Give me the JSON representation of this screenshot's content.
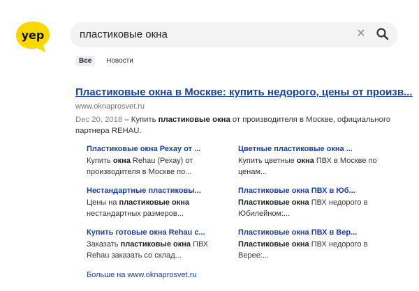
{
  "brand": {
    "logo_text": "yep",
    "color": "#f9d800"
  },
  "search": {
    "query": "пластиковые окна",
    "clear_icon": "close-icon",
    "search_icon": "search-icon"
  },
  "tabs": [
    {
      "label": "Все",
      "active": true
    },
    {
      "label": "Новости",
      "active": false
    }
  ],
  "result": {
    "title": "Пластиковые окна в Москве: купить недорого, цены от произв...",
    "url": "www.oknaprosvet.ru",
    "date": "Dec 20, 2018",
    "snippet_pre": " – Купить ",
    "snippet_bold": "пластиковые окна",
    "snippet_post": " от производителя в Москве, официального партнера REHAU."
  },
  "sitelinks": [
    {
      "title": "Пластиковые окна Рехау от ...",
      "desc": [
        [
          "Купить ",
          false
        ],
        [
          "окна",
          true
        ],
        [
          " Rehau (Рехау) от производителя в Москве по...",
          false
        ]
      ]
    },
    {
      "title": "Цветные пластиковые окна ...",
      "desc": [
        [
          "Купить цветные ",
          false
        ],
        [
          "окна",
          true
        ],
        [
          " ПВХ в Москве по ценам...",
          false
        ]
      ]
    },
    {
      "title": "Нестандартные пластиковы...",
      "desc": [
        [
          "Цены на ",
          false
        ],
        [
          "пластиковые окна",
          true
        ],
        [
          " нестандартных размеров...",
          false
        ]
      ]
    },
    {
      "title": "Пластиковые окна ПВХ в Юб...",
      "desc": [
        [
          "Пластиковые окна",
          true
        ],
        [
          " ПВХ недорого в Юбилейном:...",
          false
        ]
      ]
    },
    {
      "title": "Купить готовые окна Rehau с...",
      "desc": [
        [
          "Заказать ",
          false
        ],
        [
          "пластиковые окна",
          true
        ],
        [
          " ПВХ Rehau заказать со склад...",
          false
        ]
      ]
    },
    {
      "title": "Пластиковые окна ПВХ в Вер...",
      "desc": [
        [
          "Пластиковые окна",
          true
        ],
        [
          " ПВХ недорого в Верее:...",
          false
        ]
      ]
    }
  ],
  "more_link": "Больше на www.oknaprosvet.ru"
}
